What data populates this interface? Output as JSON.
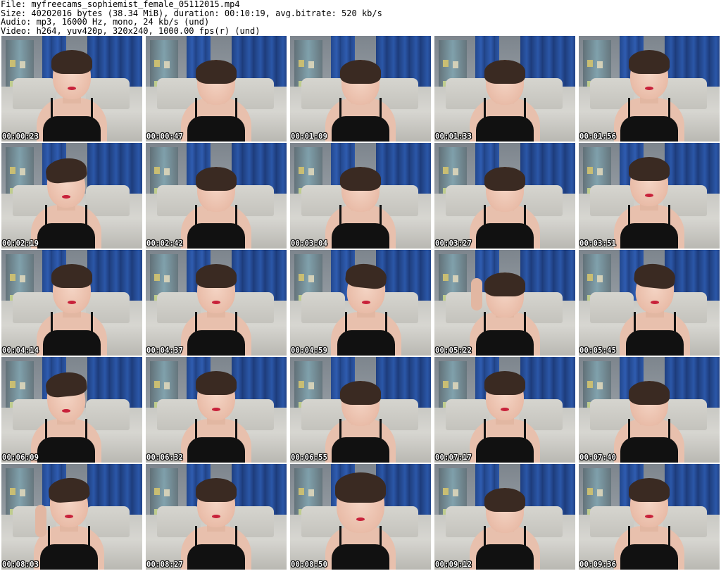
{
  "header": {
    "file_line": "File: myfreecams_sophiemist_female_05112015.mp4",
    "size_line": "Size: 40202016 bytes (38.34 MiB), duration: 00:10:19, avg.bitrate: 520 kb/s",
    "audio_line": "Audio: mp3, 16000 Hz, mono, 24 kb/s (und)",
    "video_line": "Video: h264, yuv420p, 320x240, 1000.00 fps(r) (und)"
  },
  "thumbnails": [
    {
      "timestamp": "00:00:23",
      "pose": "face-forward"
    },
    {
      "timestamp": "00:00:47",
      "pose": "head-down"
    },
    {
      "timestamp": "00:01:09",
      "pose": "head-down"
    },
    {
      "timestamp": "00:01:33",
      "pose": "head-down"
    },
    {
      "timestamp": "00:01:56",
      "pose": "face-forward"
    },
    {
      "timestamp": "00:02:19",
      "pose": "face-left"
    },
    {
      "timestamp": "00:02:42",
      "pose": "head-down"
    },
    {
      "timestamp": "00:03:04",
      "pose": "head-down"
    },
    {
      "timestamp": "00:03:27",
      "pose": "head-down"
    },
    {
      "timestamp": "00:03:51",
      "pose": "face-forward"
    },
    {
      "timestamp": "00:04:14",
      "pose": "face-forward"
    },
    {
      "timestamp": "00:04:37",
      "pose": "face-forward"
    },
    {
      "timestamp": "00:04:59",
      "pose": "face-right"
    },
    {
      "timestamp": "00:05:22",
      "pose": "hand-to-head"
    },
    {
      "timestamp": "00:05:45",
      "pose": "face-right"
    },
    {
      "timestamp": "00:06:09",
      "pose": "face-left"
    },
    {
      "timestamp": "00:06:32",
      "pose": "face-forward"
    },
    {
      "timestamp": "00:06:55",
      "pose": "head-down"
    },
    {
      "timestamp": "00:07:17",
      "pose": "face-forward"
    },
    {
      "timestamp": "00:07:40",
      "pose": "head-down"
    },
    {
      "timestamp": "00:08:03",
      "pose": "hand-to-face"
    },
    {
      "timestamp": "00:08:27",
      "pose": "face-forward"
    },
    {
      "timestamp": "00:08:50",
      "pose": "close-up"
    },
    {
      "timestamp": "00:09:12",
      "pose": "head-down"
    },
    {
      "timestamp": "00:09:36",
      "pose": "face-forward"
    }
  ],
  "colors": {
    "curtain": "#2b57a8",
    "wall": "#9aa1a7",
    "sofa": "#d7d6d1",
    "top": "#111111",
    "skin": "#e9bca8",
    "hair": "#3a2a22",
    "lips": "#c8213a",
    "timestamp_text": "#ffffff"
  }
}
